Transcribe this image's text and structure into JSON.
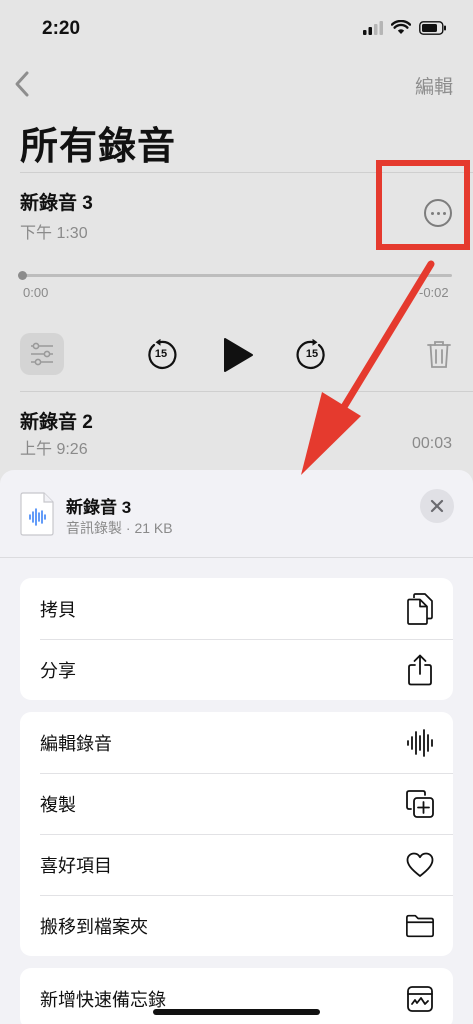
{
  "status": {
    "time": "2:20"
  },
  "nav": {
    "edit_label": "編輯"
  },
  "page": {
    "title": "所有錄音"
  },
  "recordings": [
    {
      "title": "新錄音 3",
      "time": "下午 1:30",
      "elapsed": "0:00",
      "remaining": "-0:02"
    },
    {
      "title": "新錄音 2",
      "time": "上午 9:26",
      "duration": "00:03"
    }
  ],
  "player": {
    "skip_back_label": "15",
    "skip_forward_label": "15"
  },
  "sheet": {
    "file_name": "新錄音 3",
    "file_meta": "音訊錄製 · 21 KB",
    "groups": [
      [
        {
          "label": "拷貝",
          "icon": "copy-icon"
        },
        {
          "label": "分享",
          "icon": "share-icon"
        }
      ],
      [
        {
          "label": "編輯錄音",
          "icon": "waveform-icon"
        },
        {
          "label": "複製",
          "icon": "duplicate-icon"
        },
        {
          "label": "喜好項目",
          "icon": "heart-icon"
        },
        {
          "label": "搬移到檔案夾",
          "icon": "folder-icon"
        }
      ],
      [
        {
          "label": "新增快速備忘錄",
          "icon": "quick-note-icon"
        }
      ]
    ]
  },
  "colors": {
    "annotation": "#e53a2e",
    "background": "#e5e5e5",
    "sheet": "#f2f2f6"
  }
}
